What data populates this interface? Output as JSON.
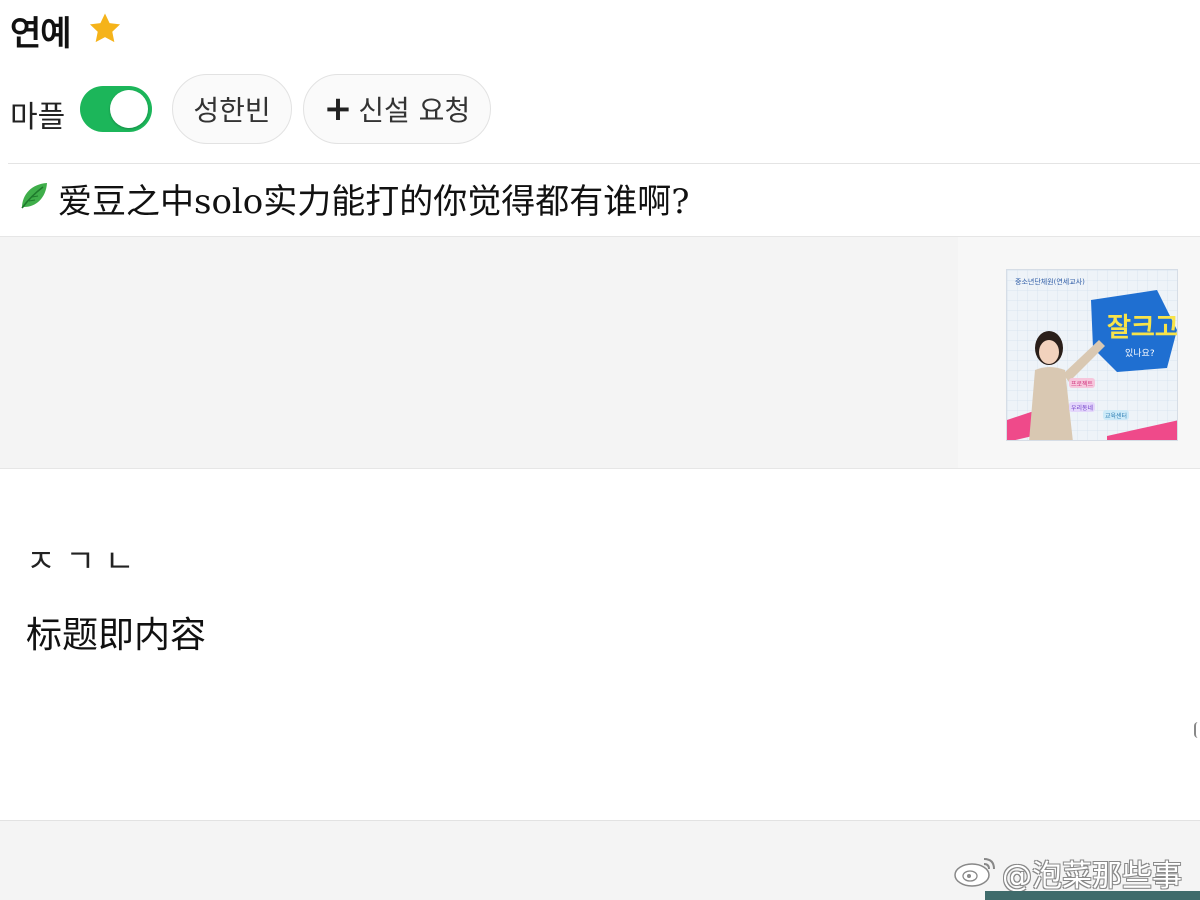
{
  "header": {
    "board_title": "연예",
    "favorite_icon": "star-icon",
    "favorite_color": "#f5b31a"
  },
  "filters": {
    "mapeul_label": "마플",
    "mapeul_toggle_on": true,
    "toggle_color": "#1cb65a",
    "member_chip": "성한빈",
    "request_chip_icon": "+",
    "request_chip_label": "신설 요청"
  },
  "post": {
    "category_icon": "leaf-icon",
    "title": "爱豆之中solo实力能打的你觉得都有谁啊?",
    "thumbnail": {
      "top_text": "중소년단체원(연세교사)",
      "headline": "잘크고",
      "subline": "있나요?",
      "tags": [
        "프로젝트",
        "우리동네",
        "교육센터"
      ]
    },
    "body_jamo": "ㅈㄱㄴ",
    "body_text": "标题即内容"
  },
  "watermark": {
    "icon": "weibo-icon",
    "text": "@泡菜那些事"
  }
}
